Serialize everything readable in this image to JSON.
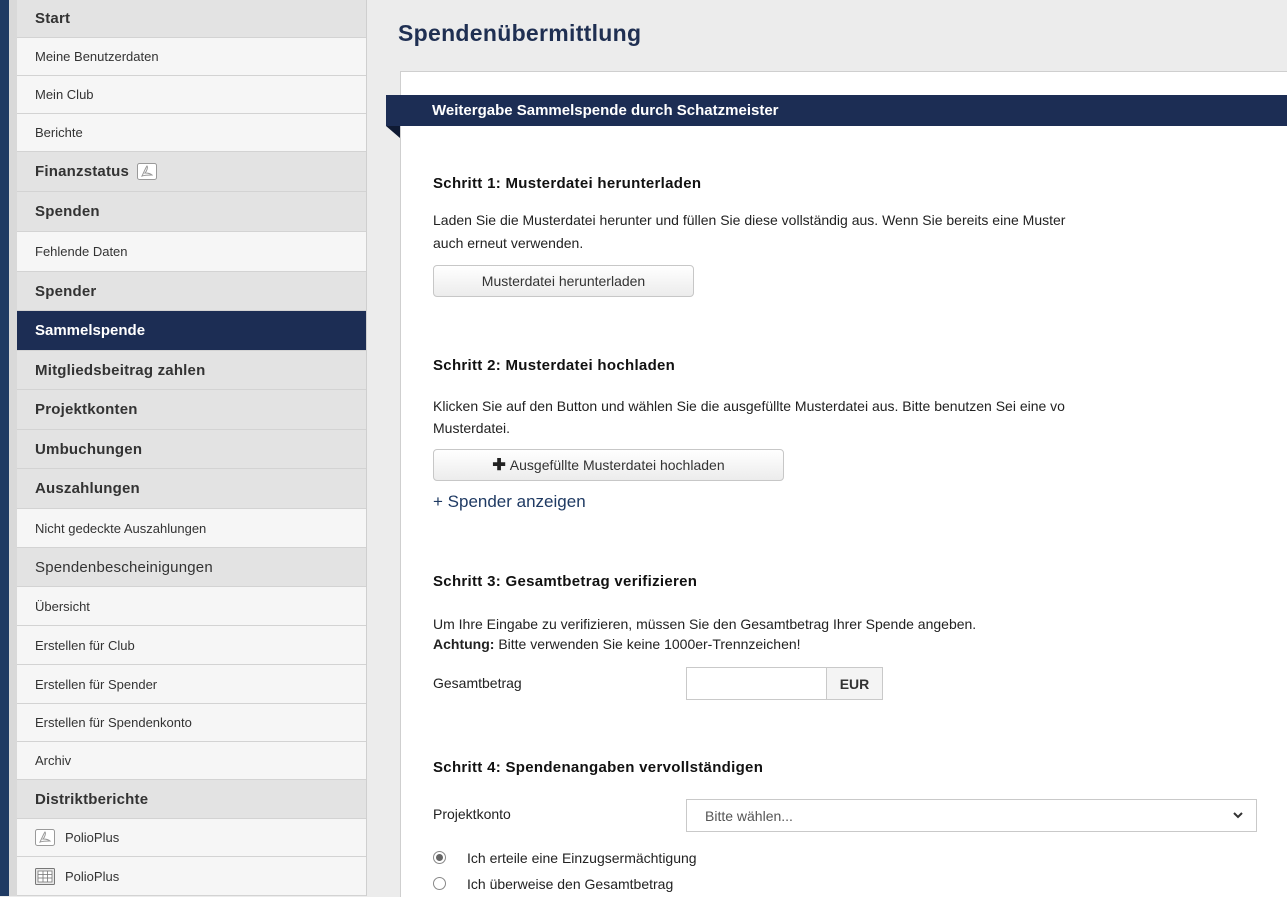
{
  "page_title": "Spendenübermittlung",
  "sidebar": {
    "items": [
      {
        "label": "Start",
        "kind": "section"
      },
      {
        "label": "Meine Benutzerdaten",
        "kind": "sub"
      },
      {
        "label": "Mein Club",
        "kind": "sub"
      },
      {
        "label": "Berichte",
        "kind": "sub"
      },
      {
        "label": "Finanzstatus",
        "kind": "section",
        "icon": "pdf-icon"
      },
      {
        "label": "Spenden",
        "kind": "section"
      },
      {
        "label": "Fehlende Daten",
        "kind": "sub"
      },
      {
        "label": "Spender",
        "kind": "section"
      },
      {
        "label": "Sammelspende",
        "kind": "active"
      },
      {
        "label": "Mitgliedsbeitrag zahlen",
        "kind": "section"
      },
      {
        "label": "Projektkonten",
        "kind": "section"
      },
      {
        "label": "Umbuchungen",
        "kind": "section"
      },
      {
        "label": "Auszahlungen",
        "kind": "section"
      },
      {
        "label": "Nicht gedeckte Auszahlungen",
        "kind": "sub"
      },
      {
        "label": "Spendenbescheinigungen",
        "kind": "section"
      },
      {
        "label": "Übersicht",
        "kind": "sub"
      },
      {
        "label": "Erstellen für Club",
        "kind": "sub"
      },
      {
        "label": "Erstellen für Spender",
        "kind": "sub"
      },
      {
        "label": "Erstellen für Spendenkonto",
        "kind": "sub"
      },
      {
        "label": "Archiv",
        "kind": "sub"
      },
      {
        "label": "Distriktberichte",
        "kind": "section"
      },
      {
        "label": "PolioPlus",
        "kind": "sub",
        "icon": "pdf-icon"
      },
      {
        "label": "PolioPlus",
        "kind": "sub",
        "icon": "spreadsheet-icon"
      }
    ]
  },
  "panel": {
    "title": "Weitergabe Sammelspende durch Schatzmeister"
  },
  "step1": {
    "title": "Schritt 1: Musterdatei herunterladen",
    "text_line1": "Laden Sie die Musterdatei herunter und füllen Sie diese vollständig aus. Wenn Sie bereits eine Muster",
    "text_line2": "auch erneut verwenden.",
    "button": "Musterdatei herunterladen"
  },
  "step2": {
    "title": "Schritt 2: Musterdatei hochladen",
    "text_line1": "Klicken Sie auf den Button und wählen Sie die ausgefüllte Musterdatei aus. Bitte benutzen Sei eine vo",
    "text_line2": "Musterdatei.",
    "button": "Ausgefüllte Musterdatei hochladen",
    "button_icon": "plus-icon",
    "link": "+ Spender anzeigen"
  },
  "step3": {
    "title": "Schritt 3: Gesamtbetrag verifizieren",
    "text_line1": "Um Ihre Eingabe zu verifizieren, müssen Sie den Gesamtbetrag Ihrer Spende angeben.",
    "warning_label": "Achtung:",
    "warning_text": " Bitte verwenden Sie keine 1000er-Trennzeichen!",
    "amount_label": "Gesamtbetrag",
    "amount_value": "",
    "currency": "EUR"
  },
  "step4": {
    "title": "Schritt 4: Spendenangaben vervollständigen",
    "project_label": "Projektkonto",
    "project_select": "Bitte wählen...",
    "radio_options": [
      {
        "label": "Ich erteile eine Einzugsermächtigung",
        "checked": true
      },
      {
        "label": "Ich überweise den Gesamtbetrag",
        "checked": false
      }
    ]
  },
  "colors": {
    "navy": "#1c2d54",
    "title_blue": "#1f2f52"
  }
}
